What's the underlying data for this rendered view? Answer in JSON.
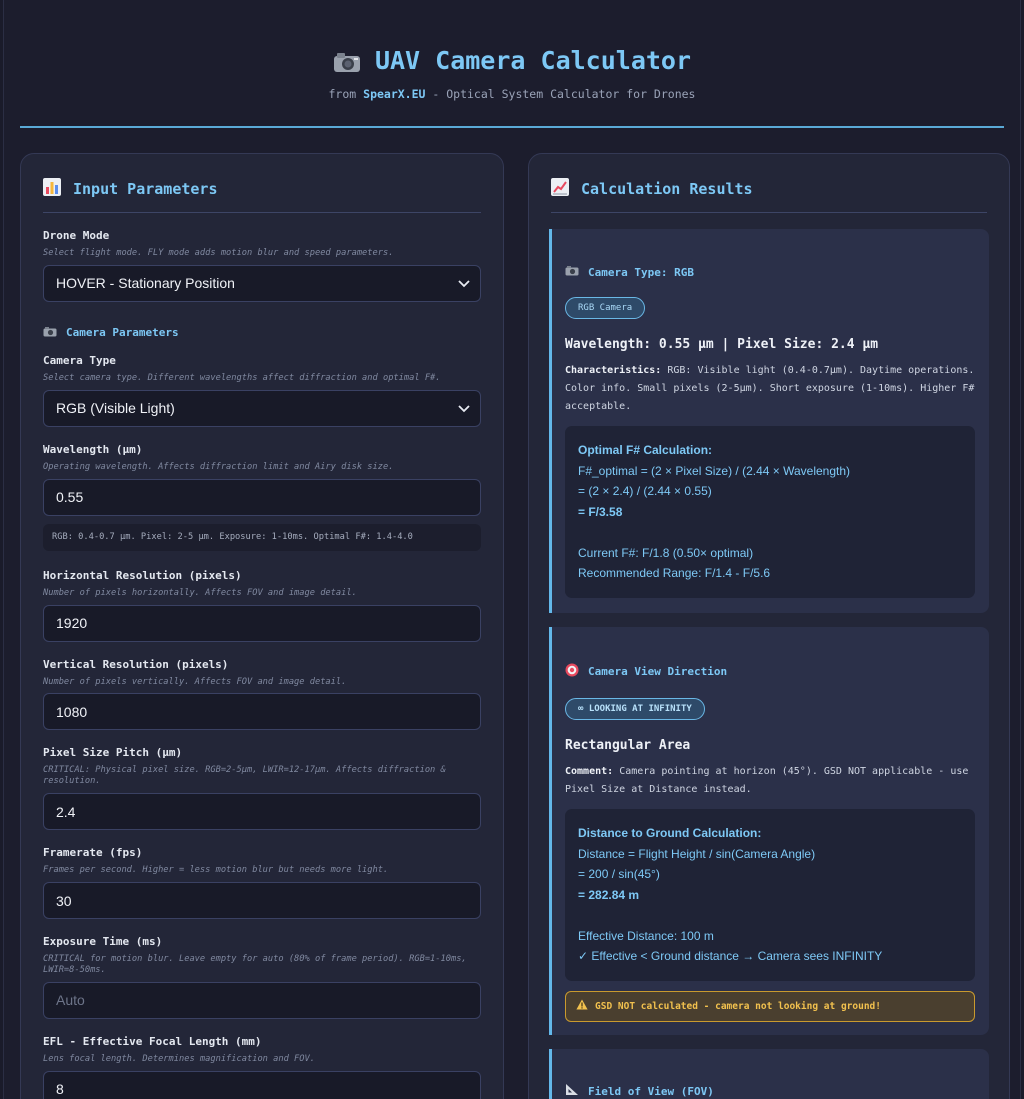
{
  "header": {
    "title": "UAV Camera Calculator",
    "subtitle_prefix": "from",
    "brand": "SpearX.EU",
    "subtitle_suffix": " - Optical System Calculator for Drones"
  },
  "left": {
    "panel_title": "Input Parameters",
    "drone_mode": {
      "label": "Drone Mode",
      "hint": "Select flight mode. FLY mode adds motion blur and speed parameters.",
      "value": "HOVER - Stationary Position"
    },
    "camera_section_title": "Camera Parameters",
    "camera_type": {
      "label": "Camera Type",
      "hint": "Select camera type. Different wavelengths affect diffraction and optimal F#.",
      "value": "RGB (Visible Light)"
    },
    "wavelength": {
      "label": "Wavelength (µm)",
      "hint": "Operating wavelength. Affects diffraction limit and Airy disk size.",
      "value": "0.55",
      "info": "RGB: 0.4-0.7 µm. Pixel: 2-5 µm. Exposure: 1-10ms. Optimal F#: 1.4-4.0"
    },
    "h_res": {
      "label": "Horizontal Resolution (pixels)",
      "hint": "Number of pixels horizontally. Affects FOV and image detail.",
      "value": "1920"
    },
    "v_res": {
      "label": "Vertical Resolution (pixels)",
      "hint": "Number of pixels vertically. Affects FOV and image detail.",
      "value": "1080"
    },
    "pixel_size": {
      "label": "Pixel Size Pitch (µm)",
      "hint": "CRITICAL: Physical pixel size. RGB=2-5µm, LWIR=12-17µm. Affects diffraction & resolution.",
      "value": "2.4"
    },
    "framerate": {
      "label": "Framerate (fps)",
      "hint": "Frames per second. Higher = less motion blur but needs more light.",
      "value": "30"
    },
    "exposure": {
      "label": "Exposure Time (ms)",
      "hint": "CRITICAL for motion blur. Leave empty for auto (80% of frame period). RGB=1-10ms, LWIR=8-50ms.",
      "placeholder": "Auto"
    },
    "efl": {
      "label": "EFL - Effective Focal Length (mm)",
      "hint": "Lens focal length. Determines magnification and FOV.",
      "value": "8"
    }
  },
  "right": {
    "panel_title": "Calculation Results",
    "camera_card": {
      "title": "Camera Type: RGB",
      "badge": "RGB Camera",
      "heading": "Wavelength: 0.55 µm | Pixel Size: 2.4 µm",
      "char_label": "Characteristics:",
      "char_text": " RGB: Visible light (0.4-0.7µm). Daytime operations. Color info. Small pixels (2-5µm). Short exposure (1-10ms). Higher F# acceptable.",
      "calc_head": "Optimal F# Calculation:",
      "calc_line1": "F#_optimal = (2 × Pixel Size) / (2.44 × Wavelength)",
      "calc_line2": "= (2 × 2.4) / (2.44 × 0.55)",
      "calc_line3": "= F/3.58",
      "calc_line4": "Current F#: F/1.8 (0.50× optimal)",
      "calc_line5": "Recommended Range: F/1.4 - F/5.6"
    },
    "view_card": {
      "title": "Camera View Direction",
      "badge": "∞ LOOKING AT INFINITY",
      "heading": "Rectangular Area",
      "comment_label": "Comment:",
      "comment_text": " Camera pointing at horizon (45°). GSD NOT applicable - use Pixel Size at Distance instead.",
      "calc_head": "Distance to Ground Calculation:",
      "calc_line1": "Distance = Flight Height / sin(Camera Angle)",
      "calc_line2": "= 200 / sin(45°)",
      "calc_line3": "= 282.84 m",
      "calc_line4": "Effective Distance: 100 m",
      "calc_line5": "✓ Effective < Ground distance → Camera sees INFINITY",
      "warning": "GSD NOT calculated - camera not looking at ground!"
    },
    "fov_card": {
      "title": "Field of View (FOV)"
    }
  },
  "colors": {
    "background": "#1c1d2d",
    "panel": "#232638",
    "accent": "#7dc8f5",
    "card": "#2b3049",
    "warning": "#f2c14e"
  }
}
